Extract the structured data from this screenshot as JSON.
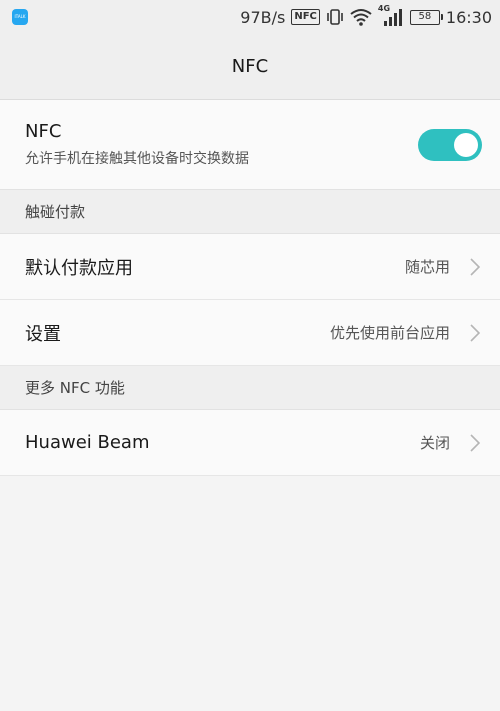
{
  "status_bar": {
    "app_badge_text": "ITALK",
    "network_speed": "97B/s",
    "nfc_indicator": "NFC",
    "signal_type": "4G",
    "battery": "58",
    "time": "16:30"
  },
  "header": {
    "title": "NFC"
  },
  "nfc": {
    "title": "NFC",
    "subtitle": "允许手机在接触其他设备时交换数据",
    "enabled": true,
    "toggle_color": "#2fc0c0"
  },
  "sections": [
    {
      "title": "触碰付款",
      "items": [
        {
          "label": "默认付款应用",
          "value": "随芯用"
        },
        {
          "label": "设置",
          "value": "优先使用前台应用"
        }
      ]
    },
    {
      "title": "更多 NFC 功能",
      "items": [
        {
          "label": "Huawei Beam",
          "value": "关闭"
        }
      ]
    }
  ]
}
